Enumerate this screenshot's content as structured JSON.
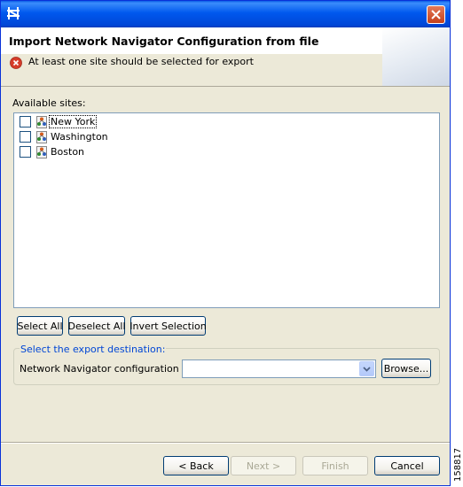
{
  "window": {
    "icon": "app-logo-icon",
    "close_icon": "close-icon"
  },
  "header": {
    "title": "Import Network Navigator Configuration from file",
    "message": "At least one site should be selected for export",
    "message_icon": "error-icon"
  },
  "sites": {
    "label": "Available sites:",
    "items": [
      {
        "label": "New York",
        "checked": false,
        "focused": true
      },
      {
        "label": "Washington",
        "checked": false,
        "focused": false
      },
      {
        "label": "Boston",
        "checked": false,
        "focused": false
      }
    ]
  },
  "selection_buttons": {
    "select_all": "Select All",
    "deselect_all": "Deselect All",
    "invert": "Invert Selection"
  },
  "destination": {
    "legend": "Select the export destination:",
    "file_label": "Network Navigator configuration file:",
    "file_value": "",
    "browse": "Browse..."
  },
  "footer": {
    "back": "< Back",
    "next": "Next >",
    "finish": "Finish",
    "cancel": "Cancel"
  },
  "side_number": "158817",
  "colors": {
    "title_bar": "#0058ee",
    "dialog_bg": "#ece9d8",
    "legend_text": "#0046d5",
    "error_red": "#d63c2a"
  }
}
